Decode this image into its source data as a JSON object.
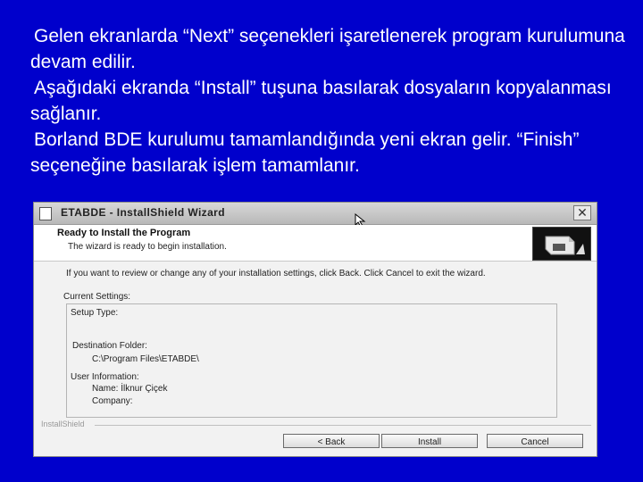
{
  "slide": {
    "line1": "Gelen ekranlarda “Next” seçenekleri işaretlenerek program kurulumuna devam edilir.",
    "line2": "Aşağıdaki ekranda “Install” tuşuna basılarak dosyaların kopyalanması sağlanır.",
    "line3": "Borland BDE kurulumu tamamlandığında yeni ekran gelir. “Finish” seçeneğine basılarak işlem tamamlanır."
  },
  "window": {
    "title": "ETABDE - InstallShield Wizard",
    "close_glyph": "✕"
  },
  "header": {
    "title": "Ready to Install the Program",
    "subtitle": "The wizard is ready to begin installation."
  },
  "body": {
    "intro": "If you want to review or change any of your installation settings, click Back. Click Cancel to exit the wizard.",
    "current_settings_label": "Current Settings:",
    "setup_type_label": "Setup Type:",
    "destination_label": "Destination Folder:",
    "destination_value": "C:\\Program Files\\ETABDE\\",
    "user_info_label": "User Information:",
    "name_line": "Name: İlknur Çiçek",
    "company_line": "Company:"
  },
  "footer": {
    "brand": "InstallShield",
    "back_label": "< Back",
    "install_label": "Install",
    "cancel_label": "Cancel"
  },
  "colors": {
    "slide_background": "#0000cc",
    "slide_text": "#ffffff"
  }
}
